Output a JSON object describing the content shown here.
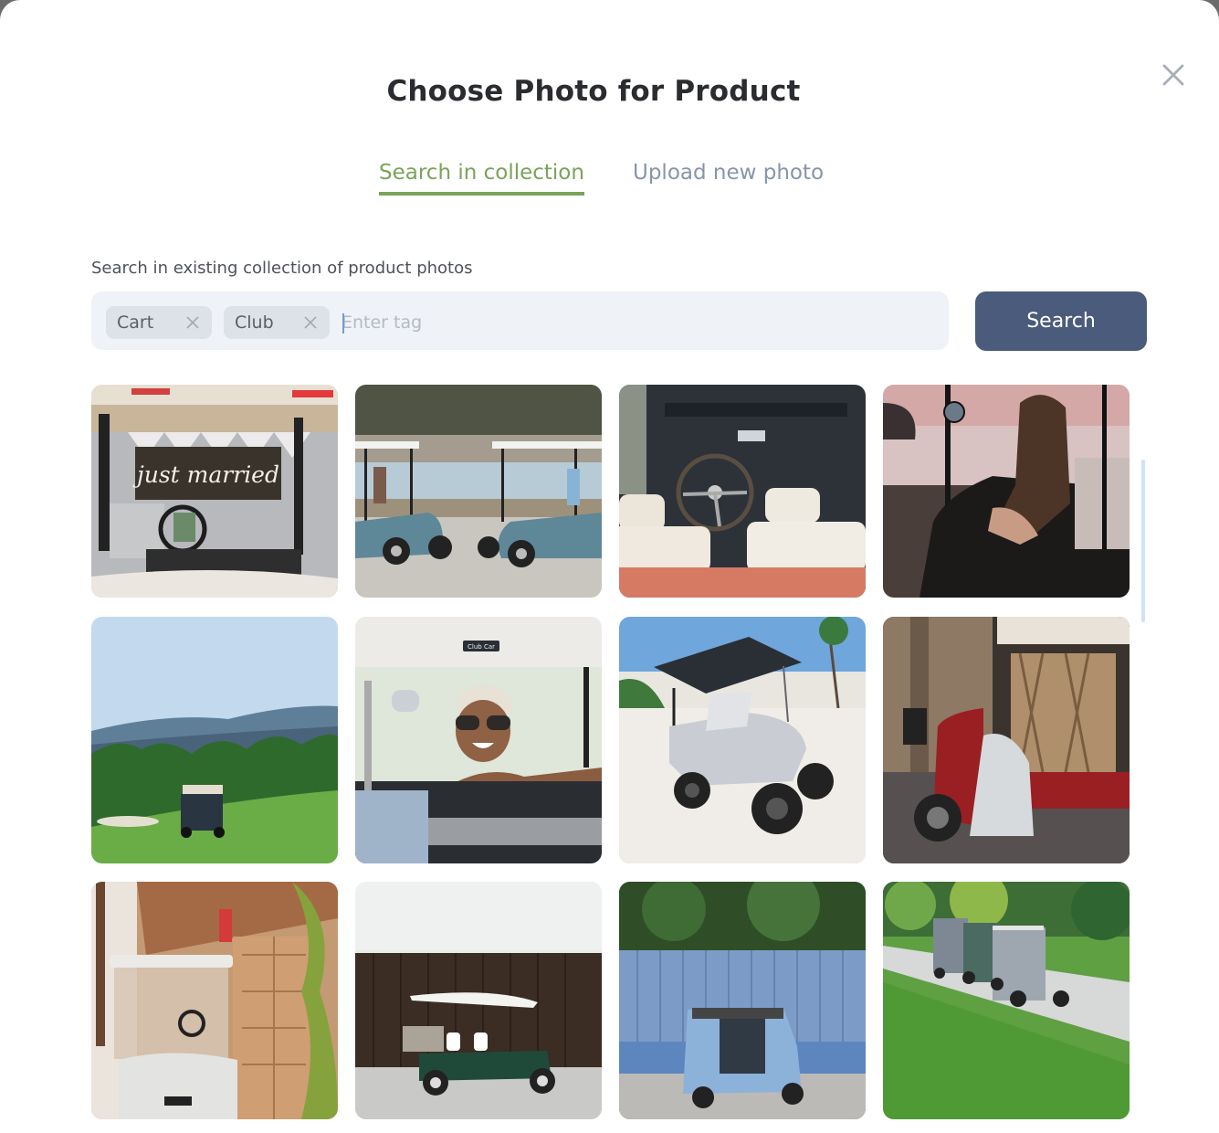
{
  "dialog": {
    "title": "Choose Photo for Product",
    "close_icon": "close-icon"
  },
  "tabs": [
    {
      "label": "Search in collection",
      "active": true
    },
    {
      "label": "Upload new photo",
      "active": false
    }
  ],
  "search": {
    "label": "Search in existing collection of product photos",
    "tags": [
      {
        "label": "Cart",
        "remove_icon": "close-icon"
      },
      {
        "label": "Club",
        "remove_icon": "close-icon"
      }
    ],
    "input_value": "",
    "input_placeholder": "Enter tag",
    "button_label": "Search"
  },
  "photos": [
    {
      "description": "Golf cart with 'just married' sign",
      "sign_text": "just married"
    },
    {
      "description": "Two teal golf carts facing each other by a lake"
    },
    {
      "description": "Convertible car interior with steering wheel and cream seats"
    },
    {
      "description": "Woman sitting in golf cart at sunset beach"
    },
    {
      "description": "Golf cart on green fairway with mountains"
    },
    {
      "description": "Smiling woman in cap leaning on Club Car steering wheel",
      "brand_text": "Club Car"
    },
    {
      "description": "Silver lifted golf cart on white sand beach"
    },
    {
      "description": "Red auto rickshaw with man crouching beside it"
    },
    {
      "description": "White golf cart parked by garage with American flag"
    },
    {
      "description": "Green utility golf cart against dark wooden wall"
    },
    {
      "description": "Light blue auto rickshaw in front of blue corrugated fence"
    },
    {
      "description": "Row of golf carts on path along green lawn"
    }
  ],
  "colors": {
    "accent_active_tab": "#7ba35a",
    "inactive_tab": "#8795ab",
    "search_button": "#4b5b7b",
    "tag_box_bg": "#eff2f6",
    "chip_bg": "#dde1e8"
  }
}
